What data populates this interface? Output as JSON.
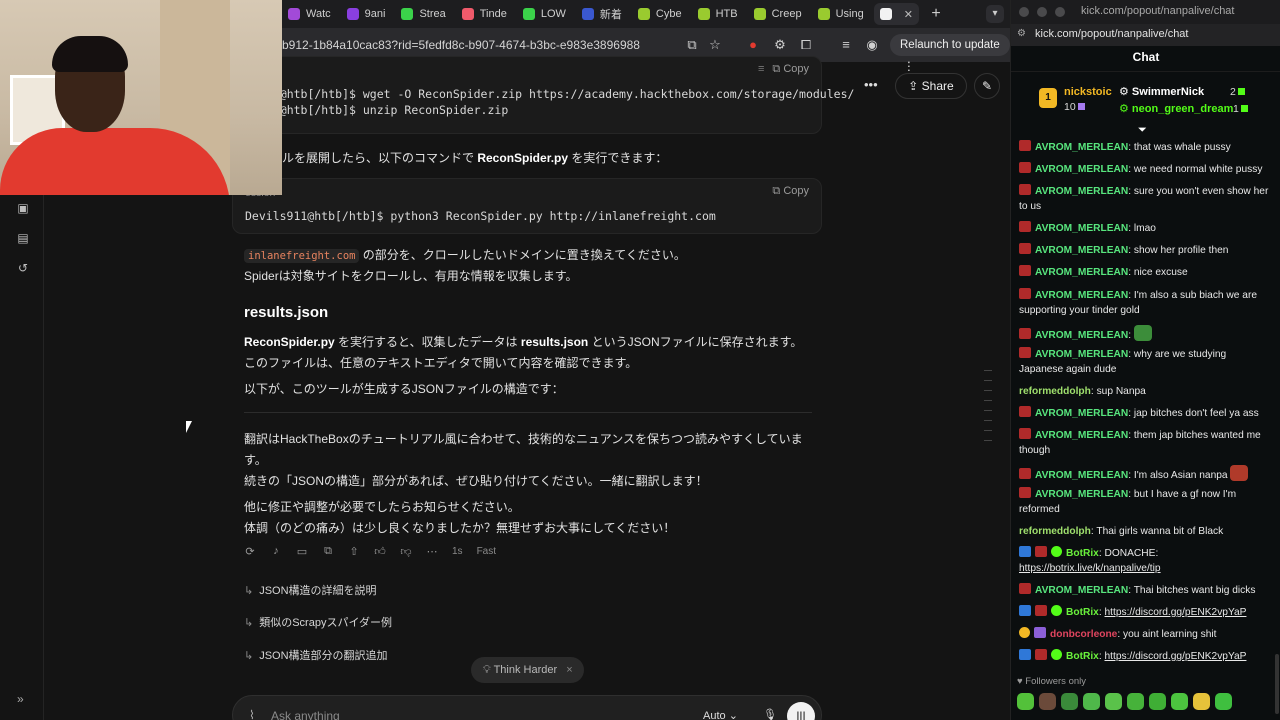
{
  "left_browser": {
    "tabs": [
      {
        "label": "Watc",
        "color": "#a24ad8"
      },
      {
        "label": "9ani",
        "color": "#8a3fe0"
      },
      {
        "label": "Strea",
        "color": "#3bd24a"
      },
      {
        "label": "Tinde",
        "color": "#f05a6b"
      },
      {
        "label": "LOW",
        "color": "#3bd24a"
      },
      {
        "label": "新着",
        "color": "#3a58d0"
      },
      {
        "label": "Cybe",
        "color": "#9acb2f"
      },
      {
        "label": "HTB",
        "color": "#9acb2f"
      },
      {
        "label": "Creep",
        "color": "#9acb2f"
      },
      {
        "label": "Using",
        "color": "#9acb2f"
      },
      {
        "label": "",
        "color": "#f2f2f2",
        "close": "✕"
      }
    ],
    "new_tab": "+",
    "url": "b912-1b84a10cac83?rid=5fedfd8c-b907-4674-b3bc-e983e3896988",
    "relaunch_label": "Relaunch to update"
  },
  "chat_app": {
    "share_label": "Share",
    "code_block_1": {
      "header": "ession",
      "copy_label": "Copy",
      "lines": [
        "911@htb[/htb]$ wget -O ReconSpider.zip https://academy.hackthebox.com/storage/modules/",
        "911@htb[/htb]$ unzip ReconSpider.zip"
      ]
    },
    "para_after_code1_prefix": "ルを展開したら、以下のコマンドで ",
    "para_after_code1_bold": "ReconSpider.py",
    "para_after_code1_suffix": " を実行できます：",
    "code_block_2": {
      "header": "ession",
      "copy_label": "Copy",
      "lines": [
        "Devils911@htb[/htb]$ python3 ReconSpider.py http://inlanefreight.com"
      ]
    },
    "inline_code": "inlanefreight.com",
    "para_replace": " の部分を、クロールしたいドメインに置き換えてください。",
    "para_spider": "Spiderは対象サイトをクロールし、有用な情報を収集します。",
    "heading": "results.json",
    "para_results_bold1": "ReconSpider.py",
    "para_results_mid": " を実行すると、収集したデータは ",
    "para_results_bold2": "results.json",
    "para_results_end": " というJSONファイルに保存されます。",
    "para_editor": "このファイルは、任意のテキストエディタで開いて内容を確認できます。",
    "para_structure": "以下が、このツールが生成するJSONファイルの構造です：",
    "para_translation_1": "翻訳はHackTheBoxのチュートリアル風に合わせて、技術的なニュアンスを保ちつつ読みやすくしていま",
    "para_translation_2": "す。",
    "para_continue": "続きの「JSONの構造」部分があれば、ぜひ貼り付けてください。一緒に翻訳します！",
    "para_fix": "他に修正や調整が必要でしたらお知らせください。",
    "para_health": "体調（のどの痛み）は少し良くなりましたか？無理せずお大事にしてください！",
    "meta_time": "1s",
    "meta_speed": "Fast",
    "suggestions": [
      "JSON構造の詳細を説明",
      "類似のScrapyスパイダー例",
      "JSON構造部分の翻訳追加"
    ],
    "think_harder": "Think Harder",
    "composer_placeholder": "Ask anything",
    "composer_mode": "Auto"
  },
  "right_browser": {
    "window_title": "kick.com/popout/nanpalive/chat",
    "url": "kick.com/popout/nanpalive/chat",
    "chat_title": "Chat",
    "leaderboard": [
      {
        "rank": "1",
        "name": "nickstoic",
        "count": "10"
      },
      {
        "name": "SwimmerNick",
        "count": "2"
      },
      {
        "name": "neon_green_dream",
        "count": "1"
      }
    ],
    "messages": [
      {
        "user": "AVROM_MERLEAN",
        "text": "that was whale pussy"
      },
      {
        "user": "AVROM_MERLEAN",
        "text": "we need normal white pussy"
      },
      {
        "user": "AVROM_MERLEAN",
        "text": "sure you won't even show her to us"
      },
      {
        "user": "AVROM_MERLEAN",
        "text": "lmao"
      },
      {
        "user": "AVROM_MERLEAN",
        "text": "show her profile then"
      },
      {
        "user": "AVROM_MERLEAN",
        "text": "nice excuse"
      },
      {
        "user": "AVROM_MERLEAN",
        "text": "I'm also a sub biach we are supporting your tinder gold"
      },
      {
        "user": "AVROM_MERLEAN",
        "text": ""
      },
      {
        "user": "AVROM_MERLEAN",
        "text": "why are we studying Japanese again dude"
      },
      {
        "user": "reformeddolph",
        "text": "sup Nanpa"
      },
      {
        "user": "AVROM_MERLEAN",
        "text": "jap bitches don't feel ya ass"
      },
      {
        "user": "AVROM_MERLEAN",
        "text": "them jap bitches wanted me though"
      },
      {
        "user": "AVROM_MERLEAN",
        "text": "I'm also Asian nanpa"
      },
      {
        "user": "AVROM_MERLEAN",
        "text": "but I have a gf now I'm reformed"
      },
      {
        "user": "reformeddolph",
        "text": "Thai girls wanna bit of Black"
      },
      {
        "user": "BotRix",
        "text": "DONACHE:",
        "link": "https://botrix.live/k/nanpalive/tip"
      },
      {
        "user": "AVROM_MERLEAN",
        "text": "Thai bitches want big dicks"
      },
      {
        "user": "BotRix",
        "text": "",
        "link": "https://discord.gg/pENK2vpYaP"
      },
      {
        "user": "donbcorleone",
        "text": "you aint learning shit"
      },
      {
        "user": "BotRix",
        "text": "",
        "link": "https://discord.gg/pENK2vpYaP"
      }
    ],
    "followers_only": "Followers only"
  }
}
